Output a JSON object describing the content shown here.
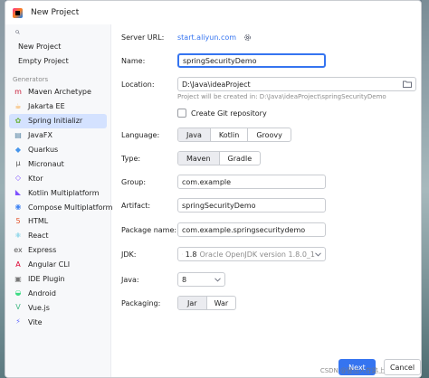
{
  "window": {
    "title": "New Project"
  },
  "sidebar": {
    "search_placeholder": "",
    "top_items": [
      {
        "label": "New Project"
      },
      {
        "label": "Empty Project"
      }
    ],
    "generators_header": "Generators",
    "generators": [
      {
        "label": "Maven Archetype",
        "icon": "maven-icon",
        "glyph": "m",
        "color": "#c71a36"
      },
      {
        "label": "Jakarta EE",
        "icon": "jakarta-icon",
        "glyph": "☕",
        "color": "#f89820"
      },
      {
        "label": "Spring Initializr",
        "icon": "spring-icon",
        "glyph": "✿",
        "color": "#6db33f",
        "selected": true
      },
      {
        "label": "JavaFX",
        "icon": "javafx-icon",
        "glyph": "▤",
        "color": "#5382a1"
      },
      {
        "label": "Quarkus",
        "icon": "quarkus-icon",
        "glyph": "◆",
        "color": "#4695eb"
      },
      {
        "label": "Micronaut",
        "icon": "micronaut-icon",
        "glyph": "μ",
        "color": "#555555"
      },
      {
        "label": "Ktor",
        "icon": "ktor-icon",
        "glyph": "◇",
        "color": "#7f52ff"
      },
      {
        "label": "Kotlin Multiplatform",
        "icon": "kotlin-icon",
        "glyph": "◣",
        "color": "#7f52ff"
      },
      {
        "label": "Compose Multiplatform",
        "icon": "compose-icon",
        "glyph": "◉",
        "color": "#4285f4"
      },
      {
        "label": "HTML",
        "icon": "html-icon",
        "glyph": "5",
        "color": "#e34f26"
      },
      {
        "label": "React",
        "icon": "react-icon",
        "glyph": "⚛",
        "color": "#20b2d8"
      },
      {
        "label": "Express",
        "icon": "express-icon",
        "glyph": "ex",
        "color": "#555555"
      },
      {
        "label": "Angular CLI",
        "icon": "angular-icon",
        "glyph": "A",
        "color": "#dd0031"
      },
      {
        "label": "IDE Plugin",
        "icon": "ide-plugin-icon",
        "glyph": "▣",
        "color": "#777777"
      },
      {
        "label": "Android",
        "icon": "android-icon",
        "glyph": "◒",
        "color": "#3ddc84"
      },
      {
        "label": "Vue.js",
        "icon": "vue-icon",
        "glyph": "V",
        "color": "#41b883"
      },
      {
        "label": "Vite",
        "icon": "vite-icon",
        "glyph": "⚡",
        "color": "#646cff"
      }
    ]
  },
  "form": {
    "server_url_label": "Server URL:",
    "server_url_value": "start.aliyun.com",
    "name_label": "Name:",
    "name_value": "springSecurityDemo",
    "location_label": "Location:",
    "location_value": "D:\\Java\\ideaProject",
    "location_note": "Project will be created in: D:\\Java\\ideaProject\\springSecurityDemo",
    "git_label": "Create Git repository",
    "language_label": "Language:",
    "languages": [
      "Java",
      "Kotlin",
      "Groovy"
    ],
    "type_label": "Type:",
    "types": [
      "Maven",
      "Gradle"
    ],
    "group_label": "Group:",
    "group_value": "com.example",
    "artifact_label": "Artifact:",
    "artifact_value": "springSecurityDemo",
    "package_label": "Package name:",
    "package_value": "com.example.springsecuritydemo",
    "jdk_label": "JDK:",
    "jdk_version": "1.8",
    "jdk_desc": "Oracle OpenJDK version 1.8.0_1",
    "java_label": "Java:",
    "java_value": "8",
    "packaging_label": "Packaging:",
    "packagings": [
      "Jar",
      "War"
    ]
  },
  "buttons": {
    "next": "Next",
    "cancel": "Cancel"
  },
  "watermark": "CSDN @登山人在路上"
}
